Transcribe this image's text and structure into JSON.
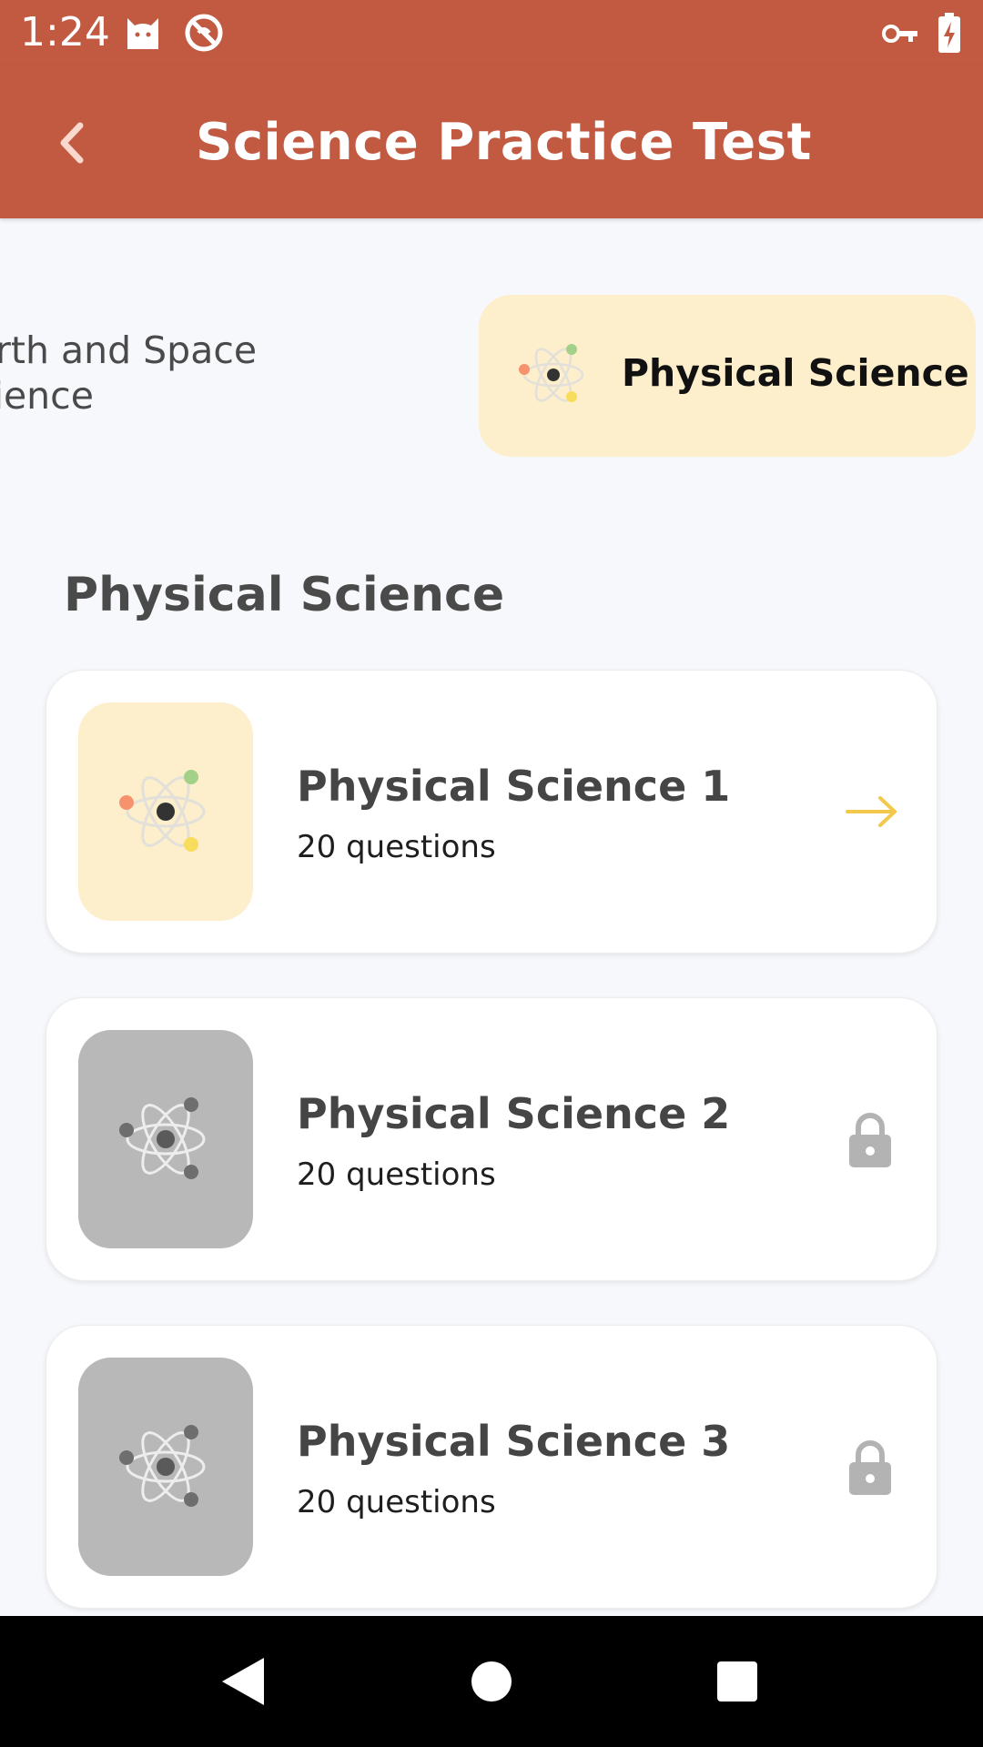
{
  "status_bar": {
    "time": "1:24",
    "icons": [
      "cat-icon",
      "do-not-disturb-icon",
      "vpn-key-icon",
      "battery-charging-icon"
    ]
  },
  "app_bar": {
    "title": "Science Practice Test",
    "back_icon": "chevron-left-icon"
  },
  "categories": {
    "previous_label": "Earth and Space Science",
    "active_label": "Physical Science",
    "active_icon": "atom-icon"
  },
  "section": {
    "title": "Physical Science"
  },
  "tests": [
    {
      "title": "Physical Science 1",
      "subtitle": "20 questions",
      "locked": false,
      "action_icon": "arrow-right-icon"
    },
    {
      "title": "Physical Science 2",
      "subtitle": "20 questions",
      "locked": true,
      "action_icon": "lock-icon"
    },
    {
      "title": "Physical Science 3",
      "subtitle": "20 questions",
      "locked": true,
      "action_icon": "lock-icon"
    }
  ],
  "nav_bar": {
    "icons": [
      "back-triangle-icon",
      "home-circle-icon",
      "recents-square-icon"
    ]
  },
  "colors": {
    "primary": "#C25A42",
    "chip_active_bg": "#FDEFCB",
    "unlocked_thumb_bg": "#FDEFCB",
    "locked_thumb_bg": "#B8B8B8",
    "arrow": "#F2C94C",
    "lock": "#B3B3B3",
    "atom_orange": "#F7926E",
    "atom_green": "#A3D18A",
    "atom_yellow": "#F8DC5C"
  }
}
